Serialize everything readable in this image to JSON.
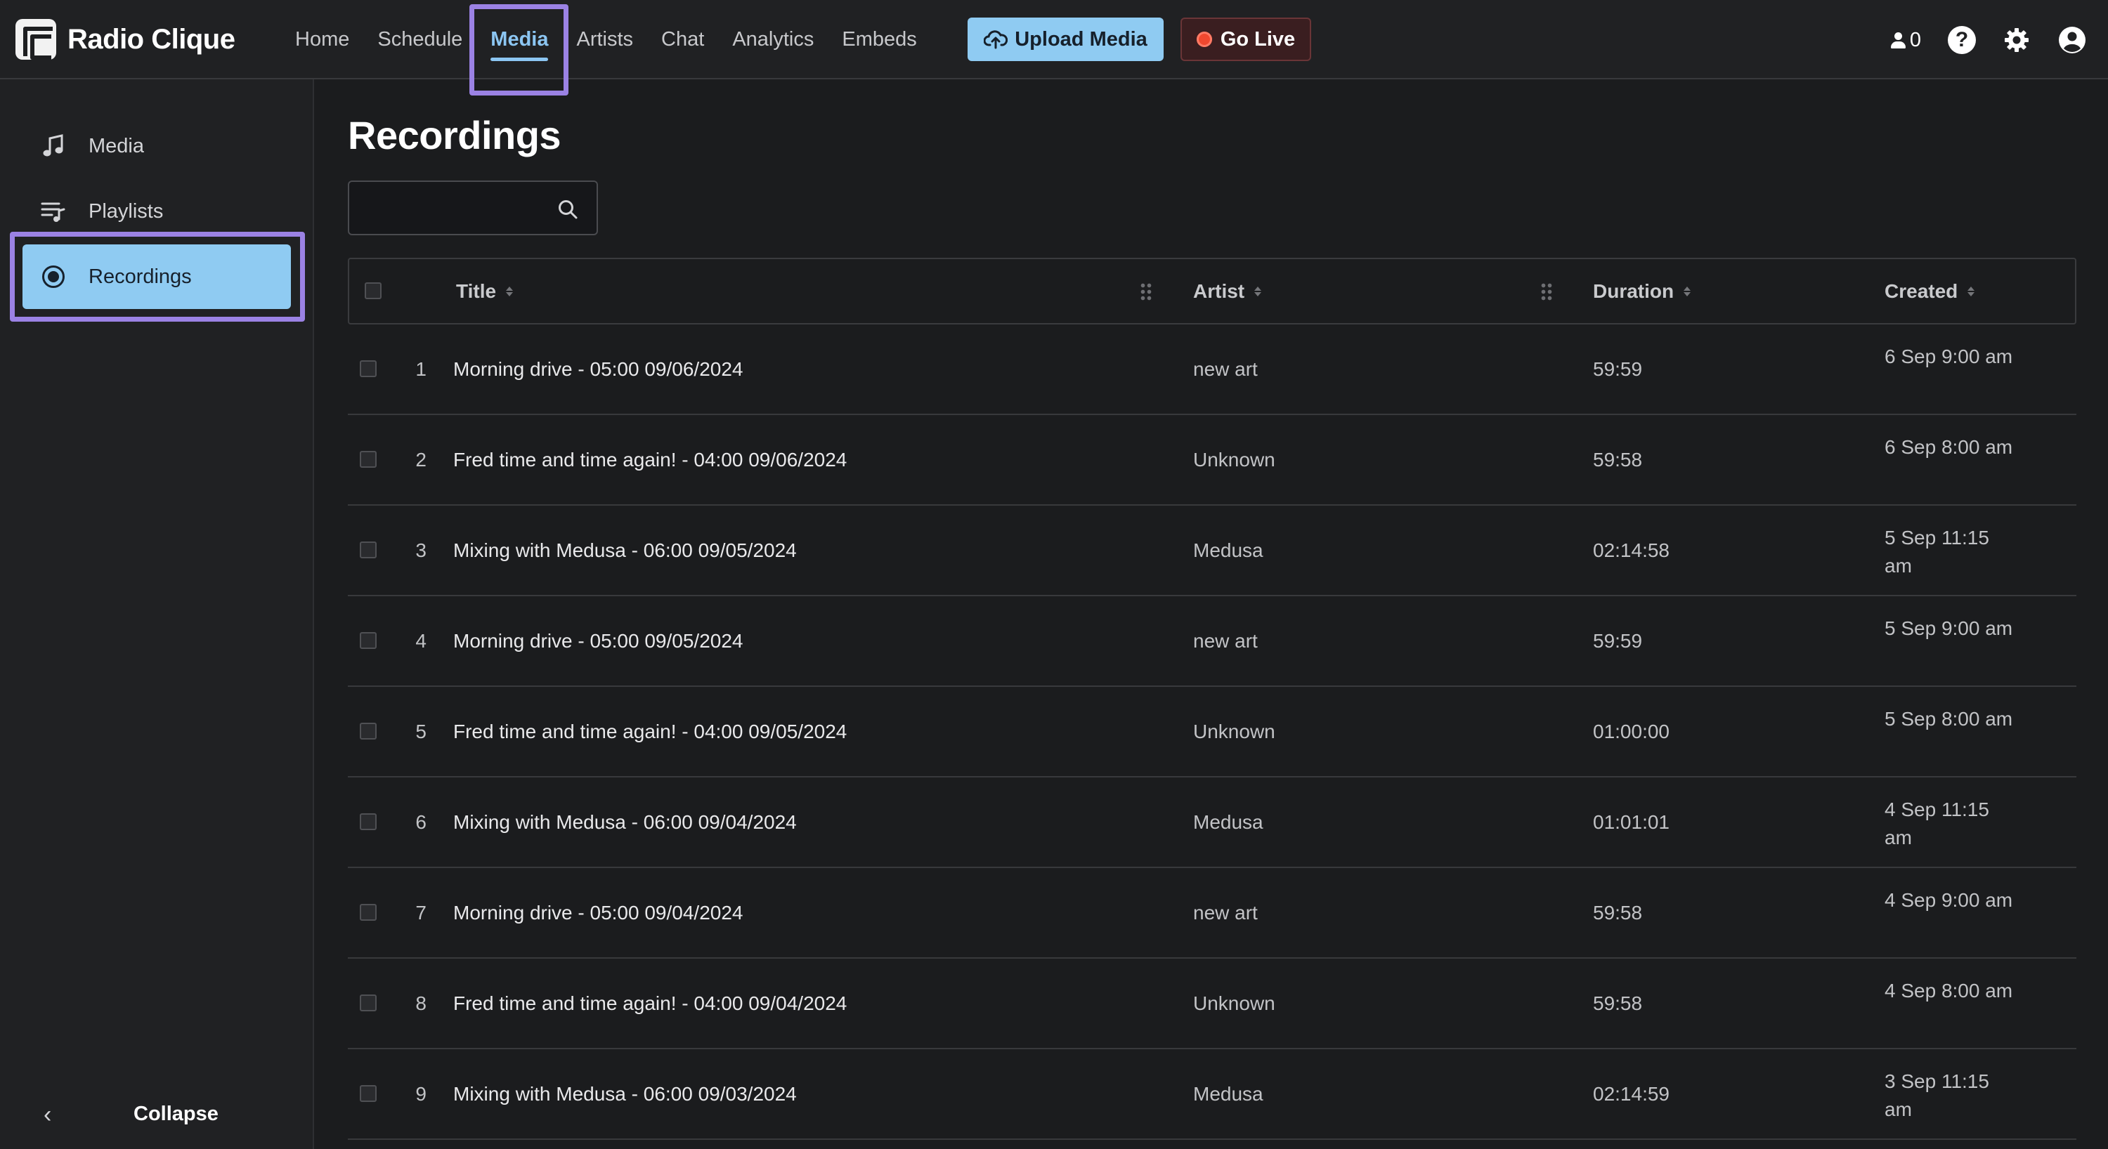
{
  "app": {
    "name": "Radio Clique"
  },
  "topnav": {
    "items": [
      {
        "label": "Home"
      },
      {
        "label": "Schedule"
      },
      {
        "label": "Media",
        "active": true
      },
      {
        "label": "Artists"
      },
      {
        "label": "Chat"
      },
      {
        "label": "Analytics"
      },
      {
        "label": "Embeds"
      }
    ],
    "upload_label": "Upload Media",
    "golive_label": "Go Live",
    "listener_count": "0"
  },
  "sidebar": {
    "items": [
      {
        "label": "Media",
        "icon": "music-note-icon"
      },
      {
        "label": "Playlists",
        "icon": "playlist-icon"
      },
      {
        "label": "Recordings",
        "icon": "record-icon",
        "active": true
      }
    ],
    "collapse_label": "Collapse"
  },
  "page": {
    "title": "Recordings",
    "search_placeholder": ""
  },
  "table": {
    "columns": {
      "title": "Title",
      "artist": "Artist",
      "duration": "Duration",
      "created": "Created"
    },
    "rows": [
      {
        "num": "1",
        "title": "Morning drive - 05:00 09/06/2024",
        "artist": "new art",
        "duration": "59:59",
        "created": "6 Sep 9:00 am"
      },
      {
        "num": "2",
        "title": "Fred time and time again! - 04:00 09/06/2024",
        "artist": "Unknown",
        "duration": "59:58",
        "created": "6 Sep 8:00 am"
      },
      {
        "num": "3",
        "title": "Mixing with Medusa - 06:00 09/05/2024",
        "artist": "Medusa",
        "duration": "02:14:58",
        "created": "5 Sep 11:15 am"
      },
      {
        "num": "4",
        "title": "Morning drive - 05:00 09/05/2024",
        "artist": "new art",
        "duration": "59:59",
        "created": "5 Sep 9:00 am"
      },
      {
        "num": "5",
        "title": "Fred time and time again! - 04:00 09/05/2024",
        "artist": "Unknown",
        "duration": "01:00:00",
        "created": "5 Sep 8:00 am"
      },
      {
        "num": "6",
        "title": "Mixing with Medusa - 06:00 09/04/2024",
        "artist": "Medusa",
        "duration": "01:01:01",
        "created": "4 Sep 11:15 am"
      },
      {
        "num": "7",
        "title": "Morning drive - 05:00 09/04/2024",
        "artist": "new art",
        "duration": "59:58",
        "created": "4 Sep 9:00 am"
      },
      {
        "num": "8",
        "title": "Fred time and time again! - 04:00 09/04/2024",
        "artist": "Unknown",
        "duration": "59:58",
        "created": "4 Sep 8:00 am"
      },
      {
        "num": "9",
        "title": "Mixing with Medusa - 06:00 09/03/2024",
        "artist": "Medusa",
        "duration": "02:14:59",
        "created": "3 Sep 11:15 am"
      }
    ]
  },
  "colors": {
    "accent": "#8fcbf2",
    "highlight": "#9b82e4",
    "live": "#f0482f",
    "background": "#1b1c1e"
  }
}
